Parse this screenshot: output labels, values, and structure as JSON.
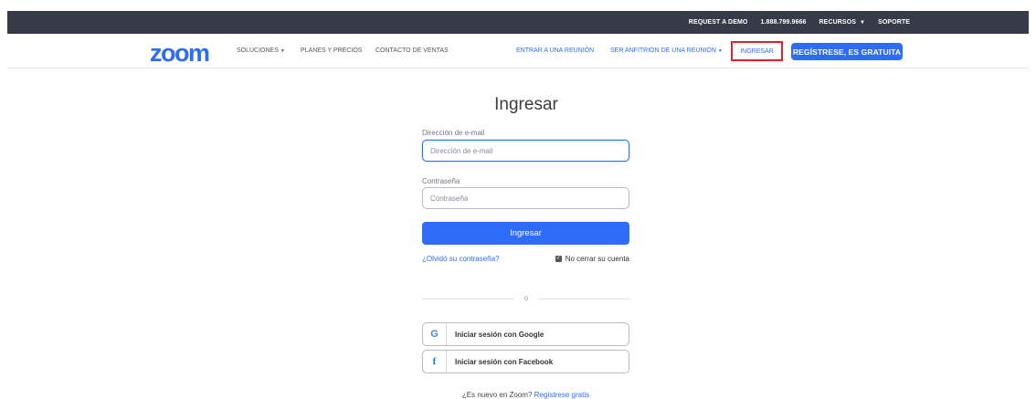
{
  "topbar": {
    "request_demo": "REQUEST A DEMO",
    "phone": "1.888.799.9666",
    "recursos": "RECURSOS",
    "soporte": "SOPORTE"
  },
  "nav": {
    "logo": "zoom",
    "soluciones": "SOLUCIONES",
    "planes": "PLANES Y PRECIOS",
    "contacto": "CONTACTO DE VENTAS",
    "entrar": "ENTRAR A UNA REUNIÓN",
    "anfitrion": "SER ANFITRIÓN DE UNA REUNIÓN",
    "ingresar": "INGRESAR",
    "signup": "REGÍSTRESE, ES GRATUITA"
  },
  "form": {
    "title": "Ingresar",
    "email_label": "Dirección de e-mail",
    "email_placeholder": "Dirección de e-mail",
    "password_label": "Contraseña",
    "password_placeholder": "Contraseña",
    "submit": "Ingresar",
    "forgot": "¿Olvidó su contraseña?",
    "stay_signed": "No cerrar su cuenta",
    "divider": "o",
    "google": "Iniciar sesión con Google",
    "facebook": "Iniciar sesión con Facebook",
    "new_prefix": "¿Es nuevo en Zoom?",
    "new_link": "Regístrese gratis"
  },
  "icons": {
    "google": "google-icon",
    "facebook": "facebook-icon"
  },
  "colors": {
    "brand": "#2d6cf6",
    "topbar": "#373a48",
    "highlight": "#e0222c"
  }
}
